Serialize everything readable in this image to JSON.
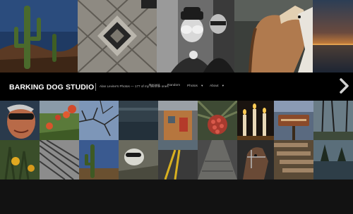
{
  "header": {
    "brand": "BARKING DOG STUDIO",
    "tagline": "Alan Levine's Photos — 177 of my favorite ones"
  },
  "nav": {
    "items": [
      {
        "label": "Recent",
        "has_menu": false
      },
      {
        "label": "Random",
        "has_menu": false
      },
      {
        "label": "Photos",
        "has_menu": true
      },
      {
        "label": "About",
        "has_menu": true
      }
    ]
  },
  "icons": {
    "next": "chevron-right-icon",
    "menu_caret": "caret-down-icon"
  },
  "photos": {
    "top": [
      "saguaro-cactus-photo",
      "wooden-lattice-photo",
      "people-hands-over-eyes-photo",
      "horse-photo",
      "sunset-water-photo"
    ],
    "bottom": [
      "woman-sunglasses-photo",
      "red-flowers-photo",
      "tree-branches-sky-photo",
      "dark-water-photo",
      "building-red-door-photo",
      "palm-seed-pod-photo",
      "candles-photo",
      "wooden-sign-photo",
      "bare-trees-photo",
      "yellow-flowers-photo",
      "palm-frond-photo",
      "cactus-blue-sky-photo",
      "dog-in-grass-photo",
      "road-yellow-lines-photo",
      "stone-path-photo",
      "horse-head-photo",
      "wooden-steps-photo",
      "lake-trees-photo"
    ]
  }
}
